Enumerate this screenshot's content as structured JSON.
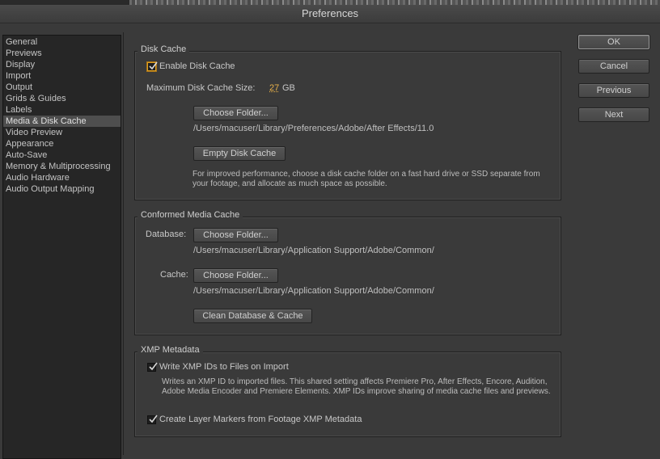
{
  "window": {
    "title": "Preferences"
  },
  "sidebar": {
    "items": [
      {
        "label": "General"
      },
      {
        "label": "Previews"
      },
      {
        "label": "Display"
      },
      {
        "label": "Import"
      },
      {
        "label": "Output"
      },
      {
        "label": "Grids & Guides"
      },
      {
        "label": "Labels"
      },
      {
        "label": "Media & Disk Cache",
        "selected": true
      },
      {
        "label": "Video Preview"
      },
      {
        "label": "Appearance"
      },
      {
        "label": "Auto-Save"
      },
      {
        "label": "Memory & Multiprocessing"
      },
      {
        "label": "Audio Hardware"
      },
      {
        "label": "Audio Output Mapping"
      }
    ]
  },
  "disk_cache": {
    "title": "Disk Cache",
    "enable_label": "Enable Disk Cache",
    "enable_checked": true,
    "max_size_label": "Maximum Disk Cache Size:",
    "max_size_value": "27",
    "max_size_unit": "GB",
    "choose_folder_label": "Choose Folder...",
    "path": "/Users/macuser/Library/Preferences/Adobe/After Effects/11.0",
    "empty_label": "Empty Disk Cache",
    "hint": "For improved performance, choose a disk cache folder on a fast hard drive or SSD separate from your footage, and allocate as much space as possible."
  },
  "conformed_cache": {
    "title": "Conformed Media Cache",
    "database_label": "Database:",
    "database_button": "Choose Folder...",
    "database_path": "/Users/macuser/Library/Application Support/Adobe/Common/",
    "cache_label": "Cache:",
    "cache_button": "Choose Folder...",
    "cache_path": "/Users/macuser/Library/Application Support/Adobe/Common/",
    "clean_label": "Clean Database & Cache"
  },
  "xmp": {
    "title": "XMP Metadata",
    "write_ids_label": "Write XMP IDs to Files on Import",
    "write_ids_checked": true,
    "write_ids_desc": "Writes an XMP ID to imported files. This shared setting affects Premiere Pro, After Effects, Encore, Audition, Adobe Media Encoder and Premiere Elements. XMP IDs improve sharing of media cache files and previews.",
    "layer_markers_label": "Create Layer Markers from Footage XMP Metadata",
    "layer_markers_checked": true
  },
  "buttons": {
    "ok": "OK",
    "cancel": "Cancel",
    "previous": "Previous",
    "next": "Next"
  }
}
